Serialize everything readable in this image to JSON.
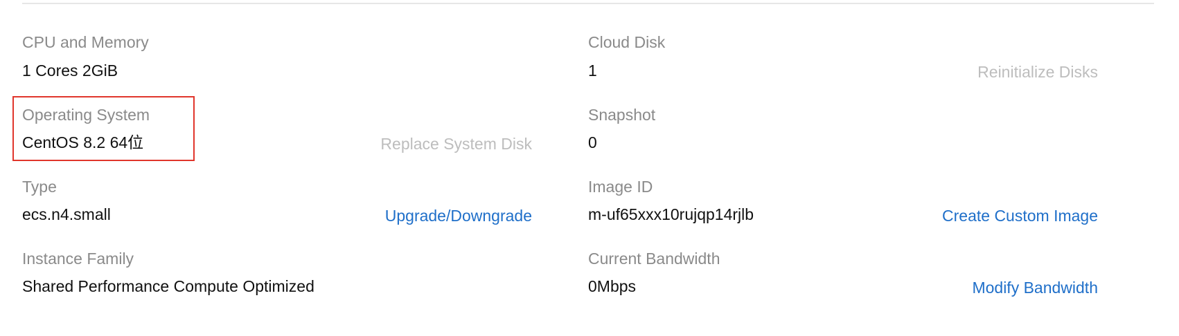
{
  "left": {
    "cpu_memory": {
      "label": "CPU and Memory",
      "value": "1 Cores 2GiB"
    },
    "operating_system": {
      "label": "Operating System",
      "value": "CentOS 8.2 64位",
      "action": "Replace System Disk"
    },
    "type": {
      "label": "Type",
      "value": "ecs.n4.small",
      "action": "Upgrade/Downgrade"
    },
    "instance_family": {
      "label": "Instance Family",
      "value": "Shared Performance Compute Optimized"
    }
  },
  "right": {
    "cloud_disk": {
      "label": "Cloud Disk",
      "value": "1",
      "action": "Reinitialize Disks"
    },
    "snapshot": {
      "label": "Snapshot",
      "value": "0"
    },
    "image_id": {
      "label": "Image ID",
      "value": "m-uf65xxx10rujqp14rjlb",
      "action": "Create Custom Image"
    },
    "bandwidth": {
      "label": "Current Bandwidth",
      "value": "0Mbps",
      "action": "Modify Bandwidth"
    }
  },
  "colors": {
    "link": "#1f6fc9",
    "disabled": "#bdbdbd",
    "label": "#8a8a8a",
    "highlight": "#e0352b"
  }
}
